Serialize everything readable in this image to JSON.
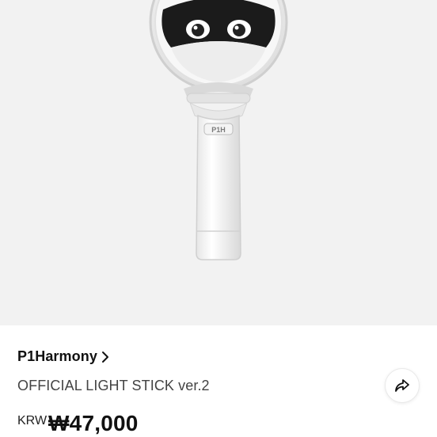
{
  "product": {
    "image_alt": "light-stick-photo",
    "brand": "P1Harmony",
    "title": "OFFICIAL LIGHT STICK ver.2",
    "logo_text": "P1H",
    "currency_code": "KRW",
    "price": "₩47,000"
  },
  "icons": {
    "brand_chevron": "chevron-right-icon",
    "share": "share-arrow-icon"
  },
  "colors": {
    "hero_background": "#f2f2f2",
    "text_primary": "#111111",
    "text_secondary": "#444444"
  }
}
